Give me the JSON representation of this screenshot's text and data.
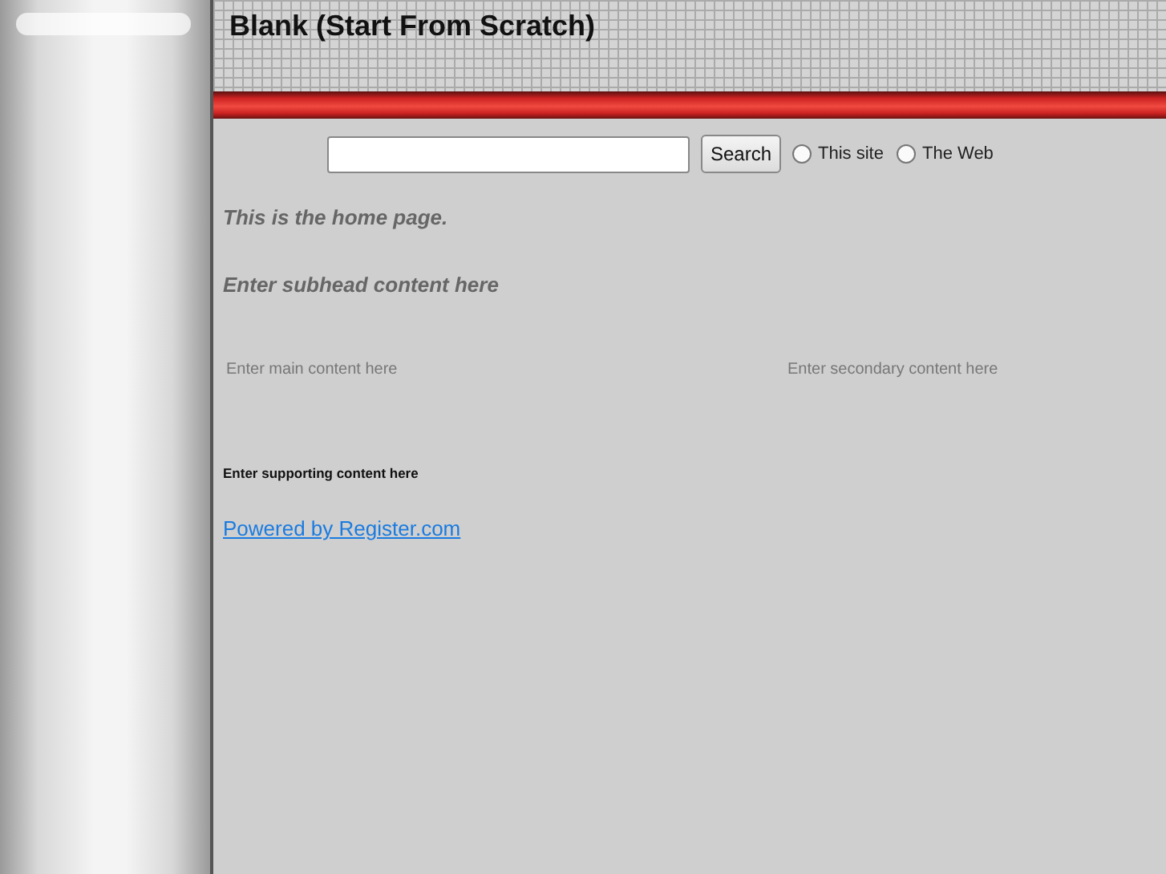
{
  "header": {
    "title": "Blank (Start From Scratch)"
  },
  "search": {
    "button": "Search",
    "scopes": [
      {
        "label": "This site",
        "selected": false
      },
      {
        "label": "The Web",
        "selected": false
      }
    ]
  },
  "heading": "This is the home page.",
  "subhead": "Enter subhead content here",
  "main_content": "Enter main content here",
  "secondary_content": "Enter secondary content here",
  "supporting_content": "Enter supporting content here",
  "footer_link": "Powered by Register.com"
}
